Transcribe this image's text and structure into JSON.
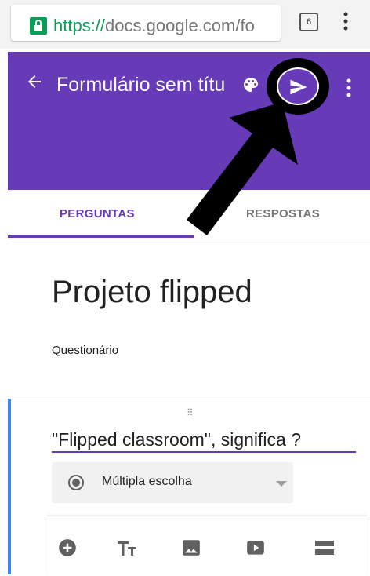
{
  "browser": {
    "url_scheme": "https://",
    "url_rest": "docs.google.com/fo",
    "tab_count": "6",
    "icons": {
      "lock": "lock-icon",
      "menu": "more-vert-icon"
    }
  },
  "header": {
    "title": "Formulário sem títu",
    "icons": [
      "arrow-back-icon",
      "palette-icon",
      "send-icon",
      "more-vert-icon"
    ],
    "color": "#673ab7"
  },
  "tabs": [
    {
      "label": "PERGUNTAS",
      "active": true
    },
    {
      "label": "RESPOSTAS",
      "active": false
    }
  ],
  "form": {
    "title": "Projeto flipped",
    "description": "Questionário"
  },
  "question": {
    "drag_handle": "⠿",
    "text": "\"Flipped classroom\", significa ?",
    "type_label": "Múltipla escolha",
    "accent": "#4285f4"
  },
  "toolbar": {
    "icons": [
      "add-circle-icon",
      "title-text-icon",
      "image-icon",
      "video-icon",
      "section-icon"
    ]
  }
}
